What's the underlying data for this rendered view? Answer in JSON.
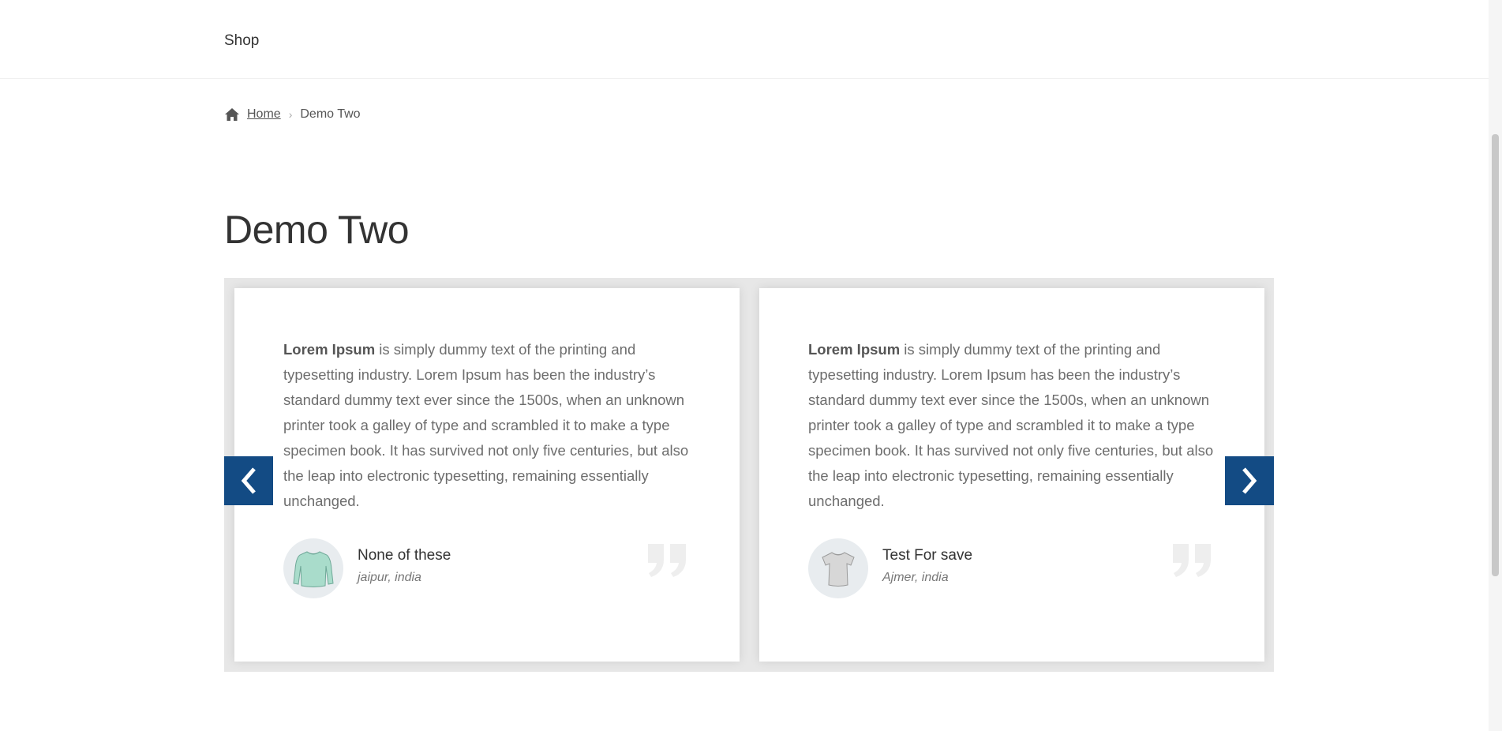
{
  "nav": {
    "shop_label": "Shop"
  },
  "breadcrumb": {
    "home_label": "Home",
    "current": "Demo Two",
    "home_icon": "home-icon"
  },
  "page": {
    "title": "Demo Two"
  },
  "testimonials": [
    {
      "bold_lead": "Lorem Ipsum",
      "text": " is simply dummy text of the printing and typesetting industry. Lorem Ipsum has been the industry’s standard dummy text ever since the 1500s, when an unknown printer took a galley of type and scrambled it to make a type specimen book. It has survived not only five centuries, but also the leap into electronic typesetting, remaining essentially unchanged.",
      "author_name": "None of these",
      "author_location": "jaipur, india",
      "avatar_icon": "long-sleeve-shirt-icon"
    },
    {
      "bold_lead": "Lorem Ipsum",
      "text": " is simply dummy text of the printing and typesetting industry. Lorem Ipsum has been the industry’s standard dummy text ever since the 1500s, when an unknown printer took a galley of type and scrambled it to make a type specimen book. It has survived not only five centuries, but also the leap into electronic typesetting, remaining essentially unchanged.",
      "author_name": "Test For save",
      "author_location": "Ajmer, india",
      "avatar_icon": "tshirt-icon"
    }
  ],
  "slider": {
    "prev_glyph": "❮",
    "next_glyph": "❯",
    "accent_color": "#134b84"
  }
}
